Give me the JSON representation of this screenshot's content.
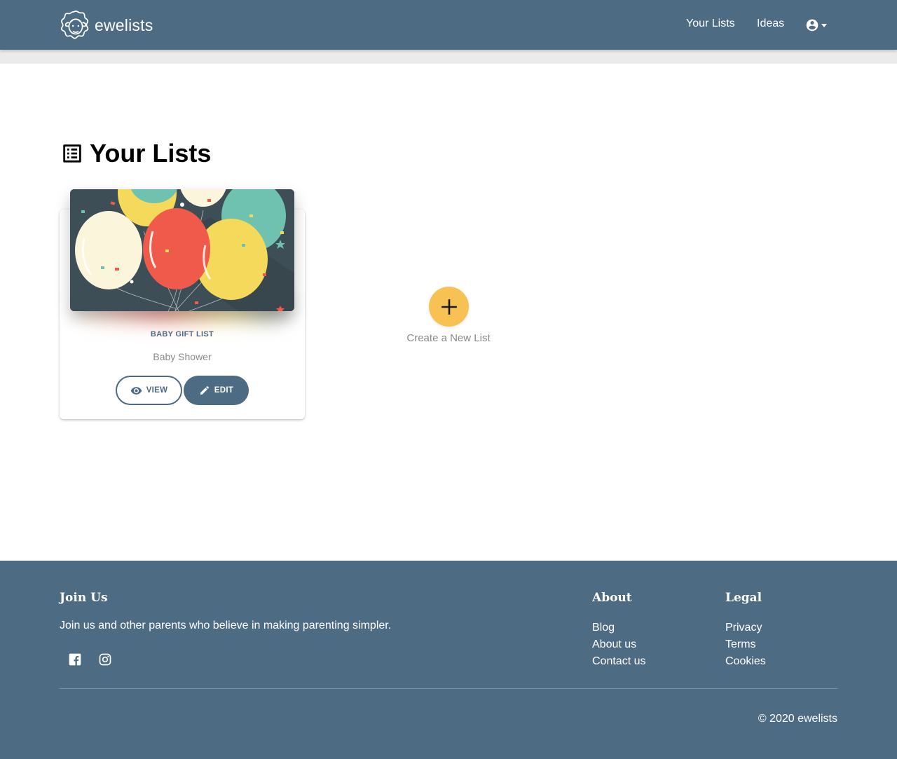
{
  "header": {
    "brand_name": "ewelists",
    "nav": [
      {
        "label": "Your Lists"
      },
      {
        "label": "Ideas"
      }
    ],
    "account_icon": "account-circle-icon"
  },
  "main": {
    "title": "Your Lists",
    "title_icon": "list-alt-icon",
    "lists": [
      {
        "category": "BABY GIFT LIST",
        "title": "Baby Shower",
        "view_label": "VIEW",
        "edit_label": "EDIT"
      }
    ],
    "create_label": "Create a New List"
  },
  "footer": {
    "join": {
      "heading": "Join Us",
      "text": "Join us and other parents who believe in making parenting simpler.",
      "social": [
        "facebook-icon",
        "instagram-icon"
      ]
    },
    "about": {
      "heading": "About",
      "links": [
        "Blog",
        "About us",
        "Contact us"
      ]
    },
    "legal": {
      "heading": "Legal",
      "links": [
        "Privacy",
        "Terms",
        "Cookies"
      ]
    },
    "copyright": "© 2020 ewelists"
  },
  "colors": {
    "primary": "#4e6b84",
    "accent": "#f8c153",
    "subbar": "#ebebeb"
  }
}
